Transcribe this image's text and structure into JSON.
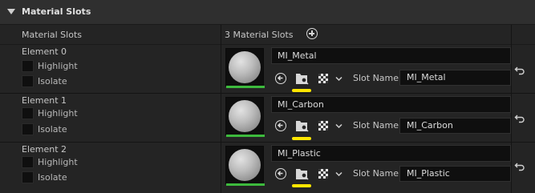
{
  "section": {
    "title": "Material Slots"
  },
  "summary": {
    "label": "Material Slots",
    "count_text": "3 Material Slots"
  },
  "elements": [
    {
      "label": "Element 0",
      "highlight_label": "Highlight",
      "isolate_label": "Isolate",
      "material_name": "MI_Metal",
      "slot_name_label": "Slot Name",
      "slot_name_value": "MI_Metal"
    },
    {
      "label": "Element 1",
      "highlight_label": "Highlight",
      "isolate_label": "Isolate",
      "material_name": "MI_Carbon",
      "slot_name_label": "Slot Name",
      "slot_name_value": "MI_Carbon"
    },
    {
      "label": "Element 2",
      "highlight_label": "Highlight",
      "isolate_label": "Isolate",
      "material_name": "MI_Plastic",
      "slot_name_label": "Slot Name",
      "slot_name_value": "MI_Plastic"
    }
  ],
  "icons": {
    "collapse": "triangle-down-icon",
    "add": "plus-circle-icon",
    "use_selected": "arrow-left-circle-icon",
    "browse": "folder-search-icon",
    "texture": "checkerboard-icon",
    "dropdown": "chevron-down-icon",
    "reset": "reset-arrow-icon"
  },
  "colors": {
    "highlight_underline": "#ffe600",
    "thumbnail_bar": "#3dba3d"
  }
}
